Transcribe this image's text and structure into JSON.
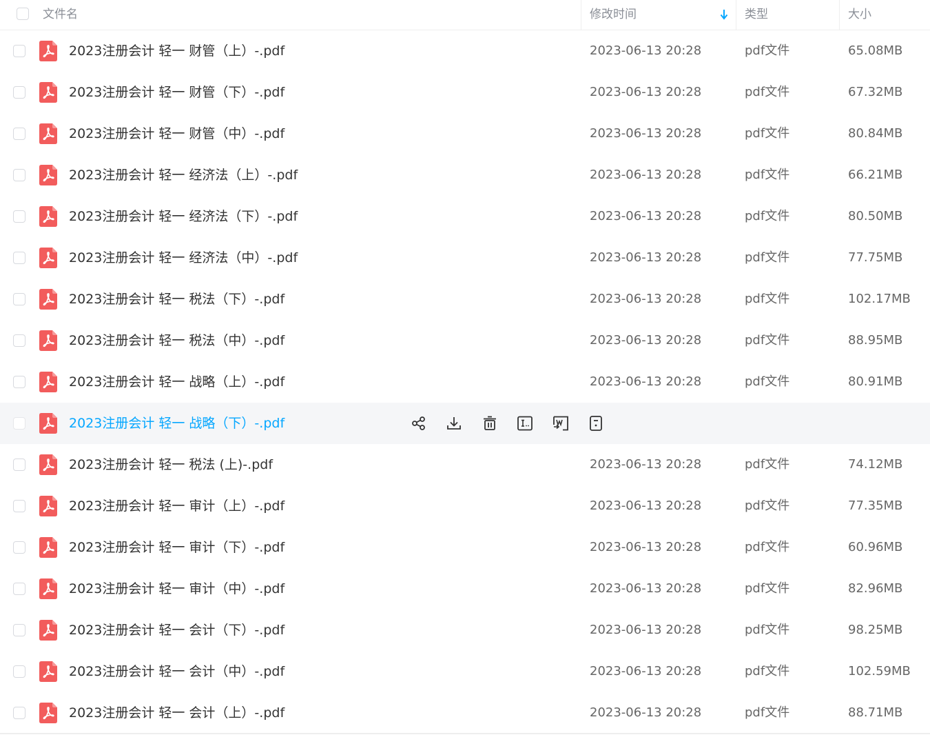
{
  "header": {
    "name_label": "文件名",
    "mtime_label": "修改时间",
    "type_label": "类型",
    "size_label": "大小",
    "sort_icon": "arrow-down-icon",
    "accent_color": "#06a7ff"
  },
  "file_icon": "pdf-file-icon",
  "hover_row_index": 9,
  "hover_actions": [
    {
      "name": "share-icon"
    },
    {
      "name": "download-icon"
    },
    {
      "name": "delete-icon"
    },
    {
      "name": "rename-icon"
    },
    {
      "name": "convert-word-icon"
    },
    {
      "name": "more-icon"
    }
  ],
  "rows": [
    {
      "name": "2023注册会计 轻一 财管（上）-.pdf",
      "mtime": "2023-06-13 20:28",
      "type": "pdf文件",
      "size": "65.08MB"
    },
    {
      "name": "2023注册会计 轻一 财管（下）-.pdf",
      "mtime": "2023-06-13 20:28",
      "type": "pdf文件",
      "size": "67.32MB"
    },
    {
      "name": "2023注册会计 轻一 财管（中）-.pdf",
      "mtime": "2023-06-13 20:28",
      "type": "pdf文件",
      "size": "80.84MB"
    },
    {
      "name": "2023注册会计 轻一 经济法（上）-.pdf",
      "mtime": "2023-06-13 20:28",
      "type": "pdf文件",
      "size": "66.21MB"
    },
    {
      "name": "2023注册会计 轻一 经济法（下）-.pdf",
      "mtime": "2023-06-13 20:28",
      "type": "pdf文件",
      "size": "80.50MB"
    },
    {
      "name": "2023注册会计 轻一 经济法（中）-.pdf",
      "mtime": "2023-06-13 20:28",
      "type": "pdf文件",
      "size": "77.75MB"
    },
    {
      "name": "2023注册会计 轻一 税法（下）-.pdf",
      "mtime": "2023-06-13 20:28",
      "type": "pdf文件",
      "size": "102.17MB"
    },
    {
      "name": "2023注册会计 轻一 税法（中）-.pdf",
      "mtime": "2023-06-13 20:28",
      "type": "pdf文件",
      "size": "88.95MB"
    },
    {
      "name": "2023注册会计 轻一 战略（上）-.pdf",
      "mtime": "2023-06-13 20:28",
      "type": "pdf文件",
      "size": "80.91MB"
    },
    {
      "name": "2023注册会计 轻一 战略（下）-.pdf",
      "mtime": "",
      "type": "",
      "size": ""
    },
    {
      "name": "2023注册会计 轻一 税法 (上)-.pdf",
      "mtime": "2023-06-13 20:28",
      "type": "pdf文件",
      "size": "74.12MB"
    },
    {
      "name": "2023注册会计 轻一 审计（上）-.pdf",
      "mtime": "2023-06-13 20:28",
      "type": "pdf文件",
      "size": "77.35MB"
    },
    {
      "name": "2023注册会计 轻一 审计（下）-.pdf",
      "mtime": "2023-06-13 20:28",
      "type": "pdf文件",
      "size": "60.96MB"
    },
    {
      "name": "2023注册会计 轻一 审计（中）-.pdf",
      "mtime": "2023-06-13 20:28",
      "type": "pdf文件",
      "size": "82.96MB"
    },
    {
      "name": "2023注册会计 轻一 会计（下）-.pdf",
      "mtime": "2023-06-13 20:28",
      "type": "pdf文件",
      "size": "98.25MB"
    },
    {
      "name": "2023注册会计 轻一 会计（中）-.pdf",
      "mtime": "2023-06-13 20:28",
      "type": "pdf文件",
      "size": "102.59MB"
    },
    {
      "name": "2023注册会计 轻一 会计（上）-.pdf",
      "mtime": "2023-06-13 20:28",
      "type": "pdf文件",
      "size": "88.71MB"
    }
  ]
}
